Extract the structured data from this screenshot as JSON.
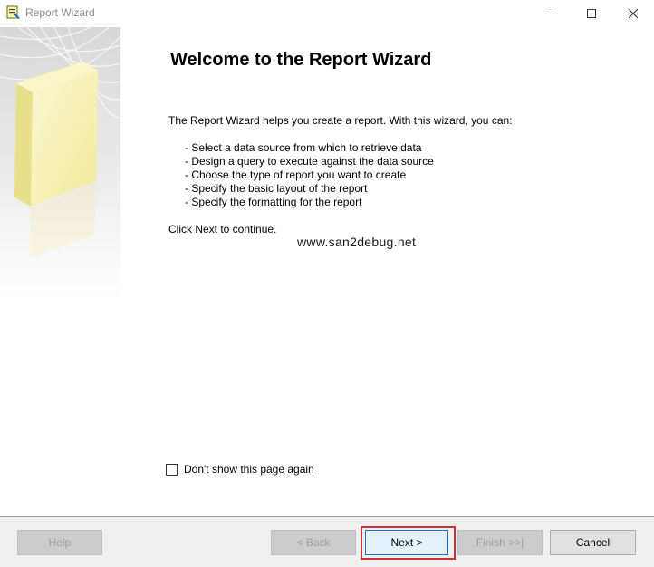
{
  "window": {
    "title": "Report Wizard",
    "icon": "report-wizard-icon"
  },
  "main": {
    "heading": "Welcome to the Report Wizard",
    "intro": "The Report Wizard helps you create a report. With this wizard, you can:",
    "bullets": [
      "- Select a data source from which to retrieve data",
      "- Design a query to execute against the data source",
      "- Choose the type of report you want to create",
      "- Specify the basic layout of the report",
      "- Specify the formatting for the report"
    ],
    "continue_text": "Click Next to continue.",
    "watermark": "www.san2debug.net"
  },
  "options": {
    "dont_show_label": "Don't show this page again",
    "dont_show_checked": false
  },
  "footer": {
    "help_label": "Help",
    "back_label": "< Back",
    "next_label": "Next >",
    "finish_label": "Finish >>|",
    "cancel_label": "Cancel"
  },
  "colors": {
    "highlight": "#d32f2f",
    "default_button_border": "#0078d7"
  }
}
